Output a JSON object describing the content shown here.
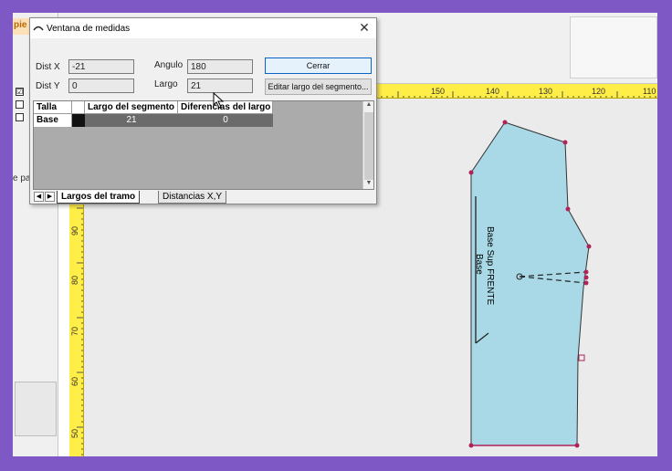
{
  "window": {
    "title": "Ventana de medidas"
  },
  "left_panel": {
    "title_fragment": "pie",
    "label_fragment": "e pa",
    "check_marks": [
      "☑",
      "",
      ""
    ]
  },
  "fields": {
    "distx": {
      "label": "Dist X",
      "value": "-21"
    },
    "disty": {
      "label": "Dist Y",
      "value": "0"
    },
    "angulo": {
      "label": "Angulo",
      "value": "180"
    },
    "largo": {
      "label": "Largo",
      "value": "21"
    }
  },
  "buttons": {
    "cerrar": "Cerrar",
    "editar": "Editar largo del segmento..."
  },
  "table": {
    "headers": [
      "Talla",
      "",
      "Largo del segmento",
      "Diferencias del largo"
    ],
    "rows": [
      {
        "talla": "Base",
        "largo": "21",
        "diferencia": "0"
      }
    ]
  },
  "tabs": {
    "largos": "Largos del tramo",
    "distancias": "Distancias X,Y"
  },
  "ruler": {
    "horizontal": [
      "150",
      "140",
      "130",
      "120",
      "110"
    ],
    "vertical": [
      "90",
      "80",
      "70",
      "60",
      "50"
    ]
  },
  "pattern": {
    "label1": "Base Sup FRENTE",
    "label2": "Base",
    "fill": "#a9d9e6",
    "point_color": "#b0235a"
  },
  "colors": {
    "ruler": "#ffed48",
    "border": "#7e58c4",
    "canvas": "#ebebeb"
  }
}
